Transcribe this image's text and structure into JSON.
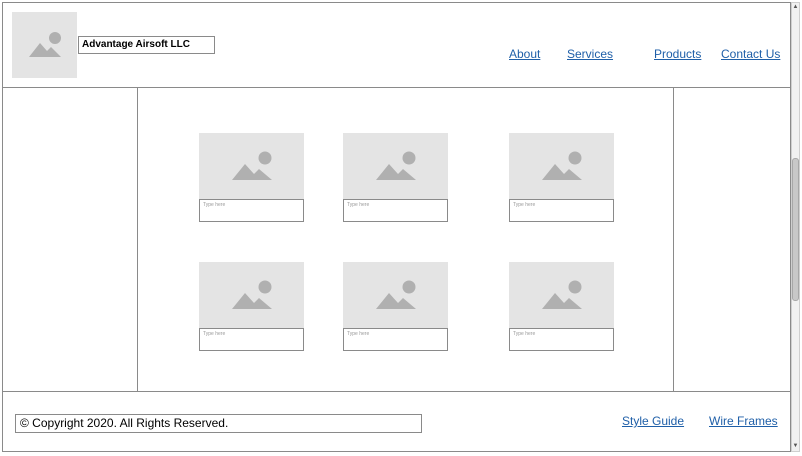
{
  "header": {
    "company_name": "Advantage Airsoft LLC",
    "nav": [
      {
        "label": "About"
      },
      {
        "label": "Services"
      },
      {
        "label": "Products"
      },
      {
        "label": "Contact Us"
      }
    ]
  },
  "gallery": {
    "items": [
      {
        "caption_placeholder": "Type here"
      },
      {
        "caption_placeholder": "Type here"
      },
      {
        "caption_placeholder": "Type here"
      },
      {
        "caption_placeholder": "Type here"
      },
      {
        "caption_placeholder": "Type here"
      },
      {
        "caption_placeholder": "Type here"
      }
    ]
  },
  "footer": {
    "copyright": "© Copyright 2020. All Rights Reserved.",
    "links": [
      {
        "label": "Style Guide"
      },
      {
        "label": "Wire Frames"
      }
    ]
  },
  "colors": {
    "link": "#1f5fa8",
    "placeholder_bg": "#e4e4e4",
    "placeholder_icon": "#b0b0b0",
    "border": "#8a8a8a"
  },
  "icons": {
    "image_placeholder": "image-placeholder-icon"
  }
}
